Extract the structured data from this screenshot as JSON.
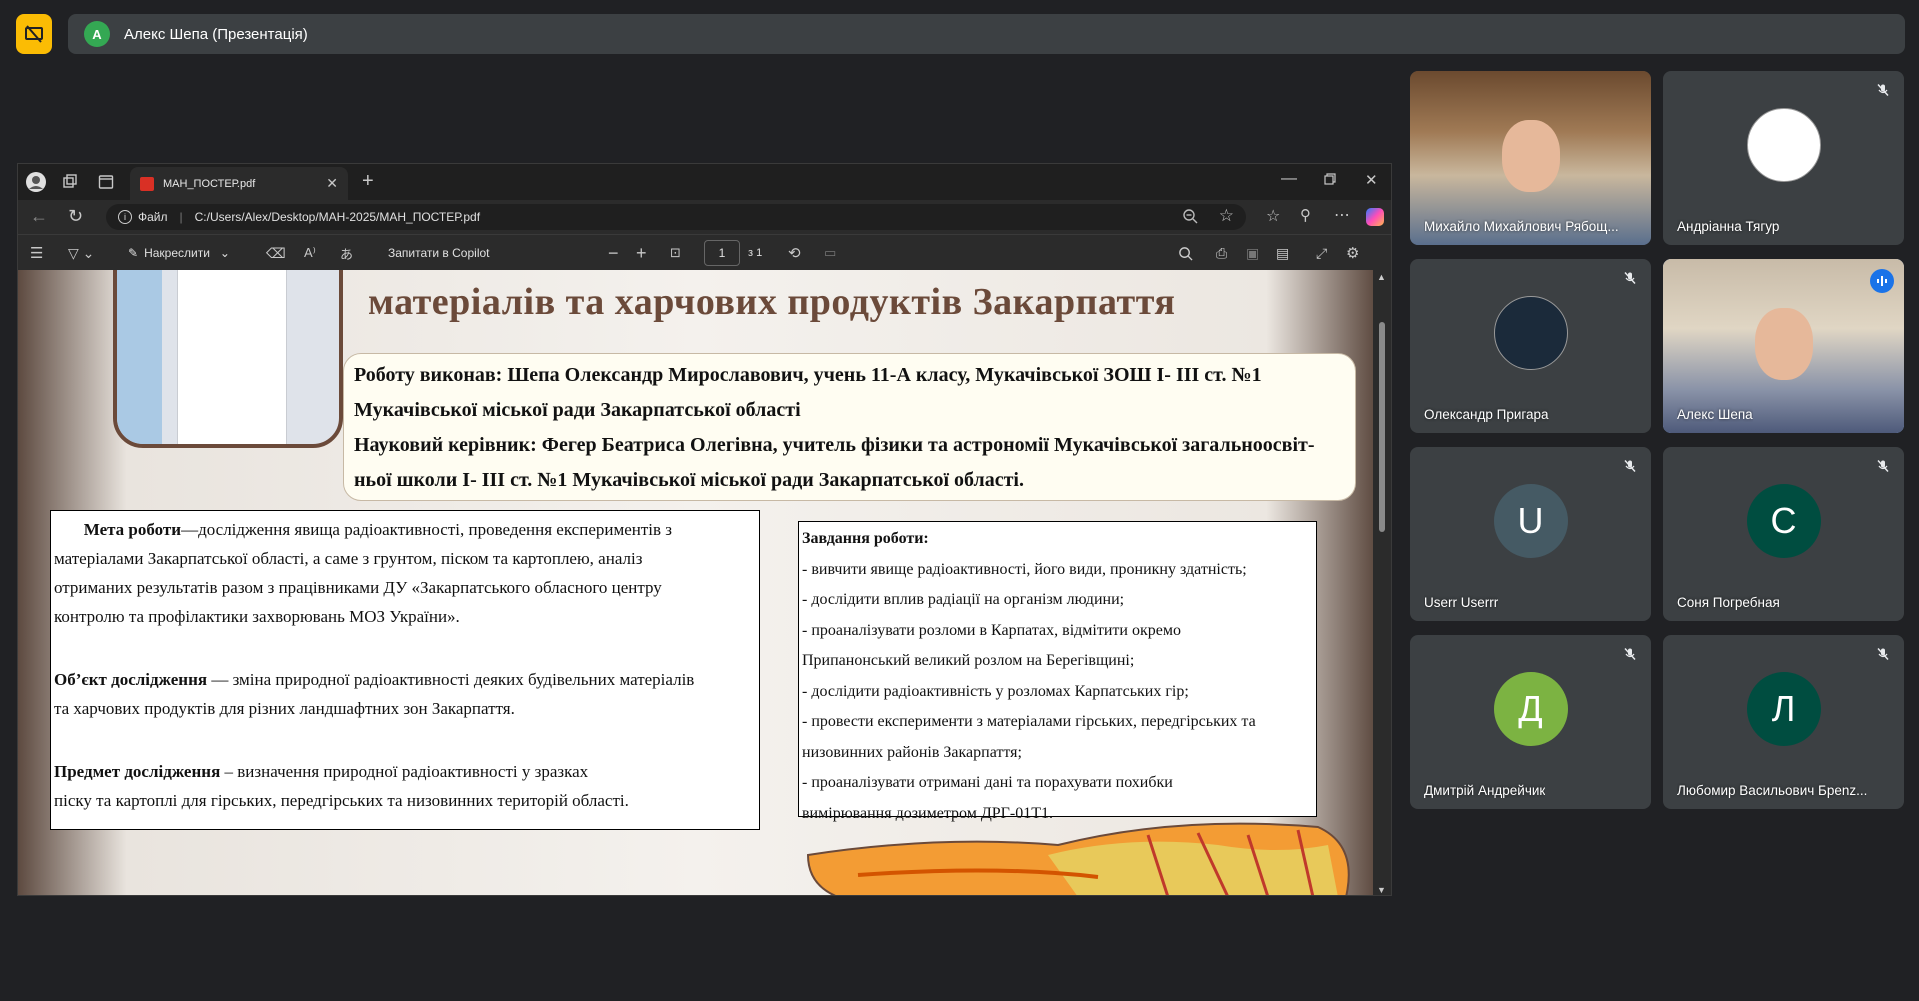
{
  "meet": {
    "presenter_initial": "А",
    "presenter_label": "Алекс Шепа (Презентація)"
  },
  "browser": {
    "tab_title": "МАН_ПОСТЕР.pdf",
    "address_prefix": "Файл",
    "address_url": "C:/Users/Alex/Desktop/МАН-2025/МАН_ПОСТЕР.pdf",
    "toolbar": {
      "draw_label": "Накреслити",
      "copilot_label": "Запитати в Copilot",
      "page_current": "1",
      "page_total": "з 1"
    }
  },
  "poster": {
    "title": "матеріалів та харчових продуктів Закарпаття",
    "authors": [
      "Роботу виконав: Шепа Олександр Мирославович, учень 11-А класу, Мукачівської ЗОШ І- ІІІ ст. №1",
      "Мукачівської міської ради Закарпатської області",
      "Науковий керівник: Фегер Беатриса Олегівна, учитель фізики та астрономії Мукачівської загальноосвіт-",
      "ньої школи І- ІІІ ст. №1 Мукачівської міської ради Закарпатської області."
    ],
    "goal": {
      "goal_label": "Мета роботи",
      "goal_lines": [
        "—дослідження явища радіоактивності, проведення експериментів з",
        "матеріалами Закарпатської області, а саме з грунтом, піском та картоплею, аналіз",
        "отриманих результатів разом з працівниками ДУ «Закарпатського обласного центру",
        "контролю та профілактики захворювань МОЗ України»."
      ],
      "object_label": "Об’єкт  дослідження",
      "object_lines": [
        " — зміна природної радіоактивності деяких будівельних матеріалів",
        "та харчових продуктів для різних ландшафтних зон Закарпаття."
      ],
      "subject_label": "Предмет дослідження",
      "subject_lines": [
        " – визначення природної радіоактивності у зразках",
        "піску та картоплі для гірських, передгірських та низовинних територій  області."
      ]
    },
    "tasks": {
      "heading": "Завдання роботи:",
      "lines": [
        "- вивчити явище радіоактивності, його види, проникну здатність;",
        "-  дослідити вплив радіації на організм людини;",
        "- проаналізувати розломи в Карпатах, відмітити окремо",
        "Припанонський великий розлом на Берегівщині;",
        "-  дослідити радіоактивність у розломах Карпатських гір;",
        "- провести експерименти з матеріалами гірських, передгірських   та",
        "низовинних районів Закарпаття;",
        "- проаналізувати отримані дані та порахувати похибки",
        "вимірювання дозиметром ДРГ-01Т1."
      ]
    }
  },
  "participants": [
    {
      "name": "Михайло Михайлович Рябощ...",
      "type": "video",
      "initial": ""
    },
    {
      "name": "Андріанна Тягур",
      "type": "avatar-image",
      "initial": "",
      "color": "#ffffff"
    },
    {
      "name": "Олександр Пригара",
      "type": "avatar-image",
      "initial": "",
      "color": "#1b2a3a"
    },
    {
      "name": "Алекс Шепа",
      "type": "video",
      "initial": ""
    },
    {
      "name": "Userr Userrr",
      "type": "initial",
      "initial": "U",
      "color": "#455a64"
    },
    {
      "name": "Соня Погребная",
      "type": "initial",
      "initial": "С",
      "color": "#004d40"
    },
    {
      "name": "Дмитрій Андрейчик",
      "type": "initial",
      "initial": "Д",
      "color": "#7cb342"
    },
    {
      "name": "Любомир Васильович Брenz...",
      "type": "initial",
      "initial": "Л",
      "color": "#004d40"
    }
  ]
}
